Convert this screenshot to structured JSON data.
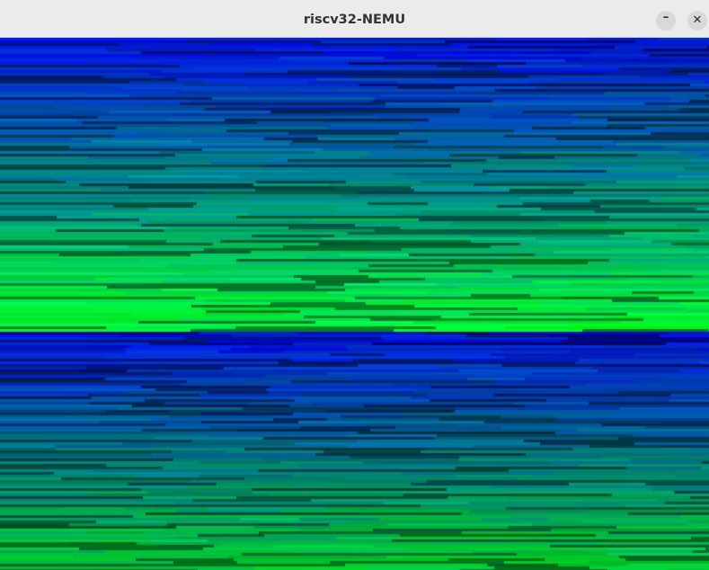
{
  "window": {
    "title": "riscv32-NEMU",
    "minimize_glyph": "–",
    "close_glyph": "✕"
  },
  "colors": {
    "titlebar_bg": "#ebebeb",
    "title_text": "#333333",
    "button_bg": "#d9d9d9",
    "gradient_top": "#0a0f8a",
    "gradient_mid": "#0a6f8a",
    "gradient_bottom": "#00ff66"
  }
}
